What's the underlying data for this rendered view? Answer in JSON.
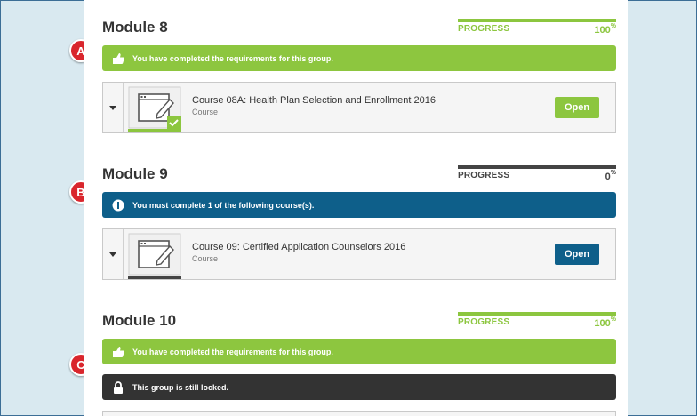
{
  "modules": [
    {
      "title": "Module 8",
      "progress_label": "PROGRESS",
      "progress_value": "100",
      "progress_unit": "%",
      "progress_fraction": 1.0,
      "banner": "You have completed the requirements for this group.",
      "course": {
        "title": "Course 08A: Health Plan Selection and Enrollment 2016",
        "type": "Course",
        "button": "Open"
      }
    },
    {
      "title": "Module 9",
      "progress_label": "PROGRESS",
      "progress_value": "0",
      "progress_unit": "%",
      "progress_fraction": 0.0,
      "banner": "You must complete 1 of the following course(s).",
      "course": {
        "title": "Course 09: Certified Application Counselors 2016",
        "type": "Course",
        "button": "Open"
      }
    },
    {
      "title": "Module 10",
      "progress_label": "PROGRESS",
      "progress_value": "100",
      "progress_unit": "%",
      "progress_fraction": 1.0,
      "banner": "You have completed the requirements for this group.",
      "locked_banner": "This group is still locked."
    }
  ],
  "markers": [
    "A",
    "B",
    "C"
  ],
  "colors": {
    "complete_green": "#8dc63f",
    "required_blue": "#0e5f8a",
    "locked_dark": "#333333",
    "marker_red": "#d9262d"
  },
  "icons": {
    "complete": "thumbs-up-icon",
    "info": "info-icon",
    "locked": "lock-icon",
    "expand": "caret-down-icon",
    "course": "course-thumbnail-icon",
    "check": "checkmark-icon"
  }
}
